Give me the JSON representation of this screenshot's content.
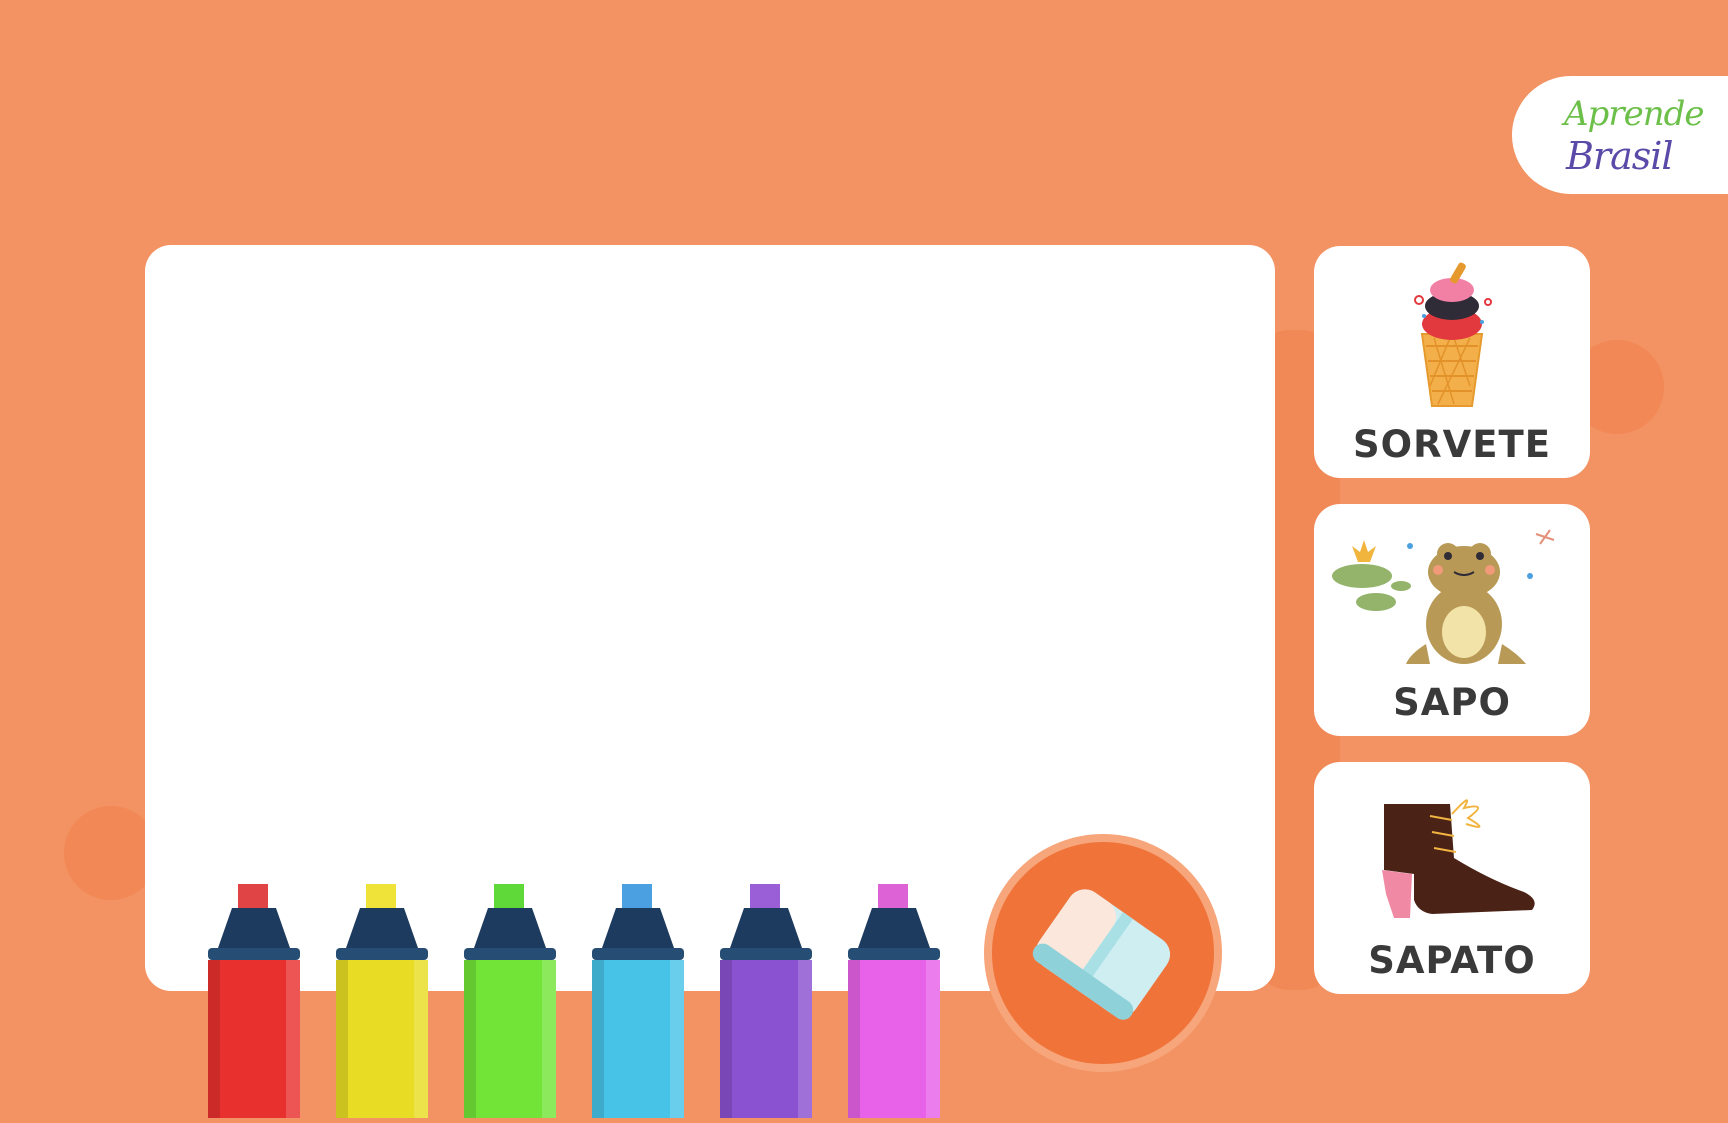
{
  "logo": {
    "line1": "Aprende",
    "line2": "Brasil"
  },
  "cards": [
    {
      "label": "SORVETE",
      "icon": "ice-cream-icon"
    },
    {
      "label": "SAPO",
      "icon": "frog-icon"
    },
    {
      "label": "SAPATO",
      "icon": "shoe-icon"
    }
  ],
  "markers": [
    {
      "color": "red",
      "body": "#e8302f",
      "tip": "#e04444"
    },
    {
      "color": "yellow",
      "body": "#e8dd24",
      "tip": "#efe239"
    },
    {
      "color": "green",
      "body": "#72e437",
      "tip": "#5fd93a"
    },
    {
      "color": "blue",
      "body": "#48c3e8",
      "tip": "#4aa0e0"
    },
    {
      "color": "purple",
      "body": "#8a51d0",
      "tip": "#9a5fd6"
    },
    {
      "color": "pink",
      "body": "#e762e8",
      "tip": "#dd62d6"
    }
  ],
  "colors": {
    "background": "#f39262",
    "accent": "#f0733a",
    "board": "#ffffff",
    "text": "#3a3a3a"
  },
  "eraser": {
    "icon": "eraser-icon"
  }
}
